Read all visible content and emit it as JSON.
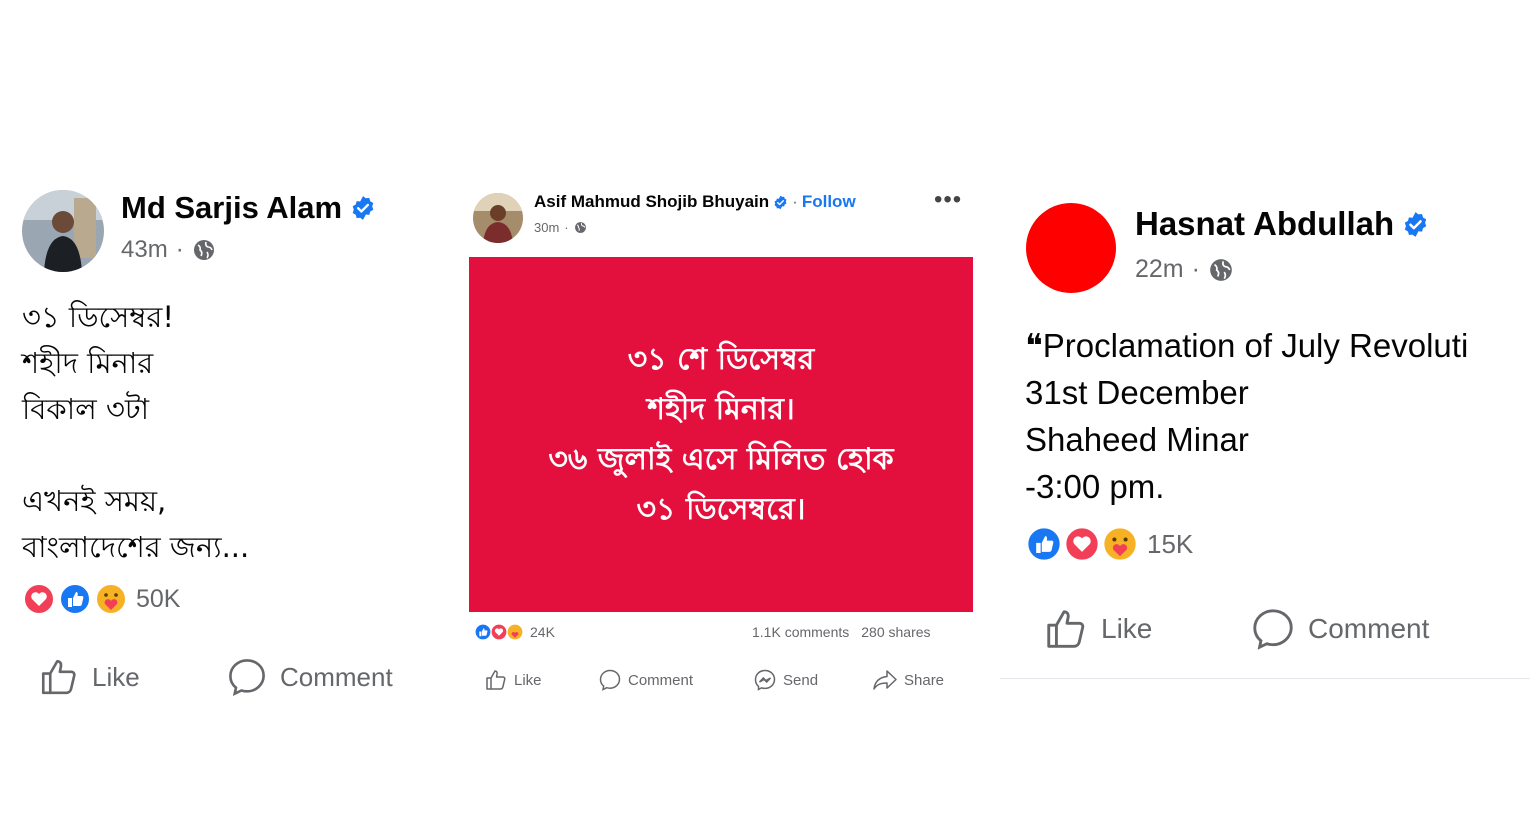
{
  "post1": {
    "author": "Md Sarjis Alam",
    "time": "43m",
    "separator": "·",
    "body_lines": [
      "৩১ ডিসেম্বর!",
      "শহীদ মিনার",
      "বিকাল ৩টা",
      "",
      "এখনই সময়,",
      "বাংলাদেশের জন্য..."
    ],
    "reaction_count": "50K",
    "like_label": "Like",
    "comment_label": "Comment"
  },
  "post2": {
    "author": "Asif Mahmud Shojib Bhuyain",
    "separator": "·",
    "follow_label": "Follow",
    "time": "30m",
    "card_text": "৩১ শে ডিসেম্বর\nশহীদ মিনার।\n৩৬ জুলাই এসে মিলিত হোক\n৩১ ডিসেম্বরে।",
    "card_color": "#e3103e",
    "reaction_count": "24K",
    "comments": "1.1K comments",
    "shares": "280 shares",
    "like_label": "Like",
    "comment_label": "Comment",
    "send_label": "Send",
    "share_label": "Share"
  },
  "post3": {
    "author": "Hasnat Abdullah",
    "time": "22m",
    "separator": "·",
    "avatar_color": "#ff0000",
    "body_lines": [
      "❝Proclamation of July Revoluti",
      "31st December",
      "Shaheed Minar",
      "-3:00 pm."
    ],
    "reaction_count": "15K",
    "like_label": "Like",
    "comment_label": "Comment"
  },
  "colors": {
    "verified": "#1877f2",
    "link": "#1877f2",
    "muted": "#65676b"
  },
  "icons": [
    "verified-badge-icon",
    "globe-icon",
    "like-reaction-icon",
    "love-reaction-icon",
    "care-reaction-icon",
    "thumbs-up-icon",
    "comment-icon",
    "messenger-send-icon",
    "share-icon",
    "more-options-icon"
  ]
}
